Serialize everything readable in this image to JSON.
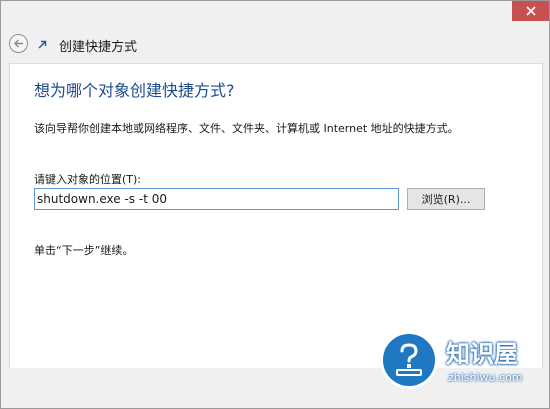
{
  "wizard": {
    "title": "创建快捷方式",
    "question": "想为哪个对象创建快捷方式?",
    "description": "该向导帮你创建本地或网络程序、文件、文件夹、计算机或 Internet 地址的快捷方式。",
    "location_label": "请键入对象的位置(T):",
    "location_value": "shutdown.exe -s -t 00",
    "browse_label": "浏览(R)...",
    "hint": "单击“下一步”继续。"
  },
  "watermark": {
    "title": "知识屋",
    "domain": "zhishiwu.com"
  },
  "icons": {
    "close": "close-icon",
    "back": "back-arrow-icon",
    "wizard": "shortcut-arrow-icon"
  },
  "colors": {
    "close_button": "#c75050",
    "heading": "#1d4b8f",
    "input_border": "#5b9bd5",
    "watermark": "#1f78c1"
  }
}
